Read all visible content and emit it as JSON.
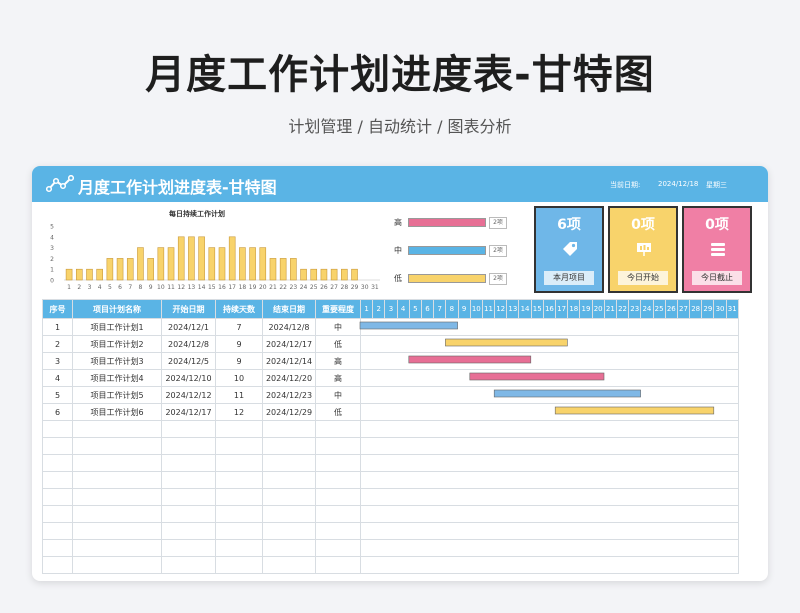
{
  "page": {
    "title": "月度工作计划进度表-甘特图",
    "subtitle": "计划管理 / 自动统计 / 图表分析"
  },
  "header": {
    "title": "月度工作计划进度表-甘特图",
    "date_label": "当前日期:",
    "date_value": "2024/12/18",
    "weekday": "星期三"
  },
  "colors": {
    "high": "#e76f95",
    "mid": "#7fb8e6",
    "low": "#f8d36b",
    "accent": "#5ab4e5"
  },
  "chart_data": {
    "type": "bar",
    "title": "每日持续工作计划",
    "categories": [
      1,
      2,
      3,
      4,
      5,
      6,
      7,
      8,
      9,
      10,
      11,
      12,
      13,
      14,
      15,
      16,
      17,
      18,
      19,
      20,
      21,
      22,
      23,
      24,
      25,
      26,
      27,
      28,
      29,
      30,
      31
    ],
    "values": [
      1,
      1,
      1,
      1,
      2,
      2,
      2,
      3,
      2,
      3,
      3,
      4,
      4,
      4,
      3,
      3,
      4,
      3,
      3,
      3,
      2,
      2,
      2,
      1,
      1,
      1,
      1,
      1,
      1,
      0,
      0
    ],
    "ylim": [
      0,
      5
    ],
    "yticks": [
      0,
      1,
      2,
      3,
      4,
      5
    ]
  },
  "priority_summary": [
    {
      "label": "高",
      "count": "2项",
      "color": "#e76f95"
    },
    {
      "label": "中",
      "count": "2项",
      "color": "#5ab4e5"
    },
    {
      "label": "低",
      "count": "2项",
      "color": "#f8d36b"
    }
  ],
  "stats": [
    {
      "value": "6项",
      "label": "本月项目",
      "icon": "tag-icon",
      "color": "#6fb7e8"
    },
    {
      "value": "0项",
      "label": "今日开始",
      "icon": "presentation-icon",
      "color": "#f8d36b"
    },
    {
      "value": "0项",
      "label": "今日截止",
      "icon": "list-icon",
      "color": "#f07fa5"
    }
  ],
  "table": {
    "headers": [
      "序号",
      "项目计划名称",
      "开始日期",
      "持续天数",
      "结束日期",
      "重要程度"
    ],
    "days": [
      1,
      2,
      3,
      4,
      5,
      6,
      7,
      8,
      9,
      10,
      11,
      12,
      13,
      14,
      15,
      16,
      17,
      18,
      19,
      20,
      21,
      22,
      23,
      24,
      25,
      26,
      27,
      28,
      29,
      30,
      31
    ],
    "rows": [
      {
        "no": "1",
        "name": "项目工作计划1",
        "start": "2024/12/1",
        "days": "7",
        "end": "2024/12/8",
        "priority": "中",
        "start_day": 1,
        "duration": 8,
        "color": "#7fb8e6"
      },
      {
        "no": "2",
        "name": "项目工作计划2",
        "start": "2024/12/8",
        "days": "9",
        "end": "2024/12/17",
        "priority": "低",
        "start_day": 8,
        "duration": 10,
        "color": "#f8d36b"
      },
      {
        "no": "3",
        "name": "项目工作计划3",
        "start": "2024/12/5",
        "days": "9",
        "end": "2024/12/14",
        "priority": "高",
        "start_day": 5,
        "duration": 10,
        "color": "#e76f95"
      },
      {
        "no": "4",
        "name": "项目工作计划4",
        "start": "2024/12/10",
        "days": "10",
        "end": "2024/12/20",
        "priority": "高",
        "start_day": 10,
        "duration": 11,
        "color": "#e76f95"
      },
      {
        "no": "5",
        "name": "项目工作计划5",
        "start": "2024/12/12",
        "days": "11",
        "end": "2024/12/23",
        "priority": "中",
        "start_day": 12,
        "duration": 12,
        "color": "#7fb8e6"
      },
      {
        "no": "6",
        "name": "项目工作计划6",
        "start": "2024/12/17",
        "days": "12",
        "end": "2024/12/29",
        "priority": "低",
        "start_day": 17,
        "duration": 13,
        "color": "#f8d36b"
      }
    ],
    "empty_rows": 9
  }
}
